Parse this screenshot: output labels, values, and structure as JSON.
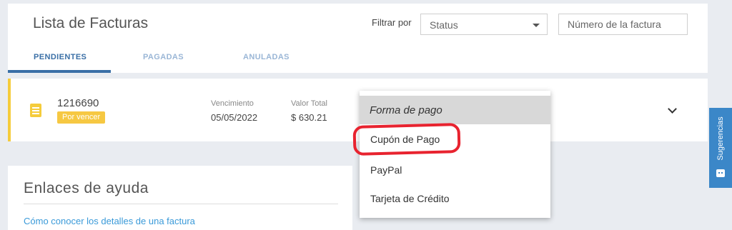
{
  "header": {
    "title": "Lista de Facturas",
    "filter_label": "Filtrar por",
    "status_select": {
      "selected": "Status"
    },
    "invoice_search": {
      "placeholder": "Número de la factura"
    }
  },
  "tabs": [
    {
      "label": "PENDIENTES",
      "active": true
    },
    {
      "label": "PAGADAS",
      "active": false
    },
    {
      "label": "ANULADAS",
      "active": false
    }
  ],
  "invoice": {
    "number": "1216690",
    "badge": "Por vencer",
    "due_label": "Vencimiento",
    "due_date": "05/05/2022",
    "total_label": "Valor Total",
    "total_value": "$ 630.21",
    "accent_color": "#f5cc3c"
  },
  "payment_dropdown": {
    "header": "Forma de pago",
    "options": [
      "Cupón de Pago",
      "PayPal",
      "Tarjeta de Crédito"
    ],
    "highlighted_option": "Cupón de Pago"
  },
  "help": {
    "title": "Enlaces de ayuda",
    "links": [
      "Cómo conocer los detalles de una factura"
    ]
  },
  "feedback_tab": {
    "label": "Sugerencias",
    "color": "#3b87c8"
  },
  "icons": [
    "document-icon",
    "chevron-down-icon",
    "smiley-icon",
    "caret-down-icon"
  ],
  "colors": {
    "primary": "#3a6fa6",
    "accent": "#f5cc3c",
    "annotation": "#e8232f"
  }
}
